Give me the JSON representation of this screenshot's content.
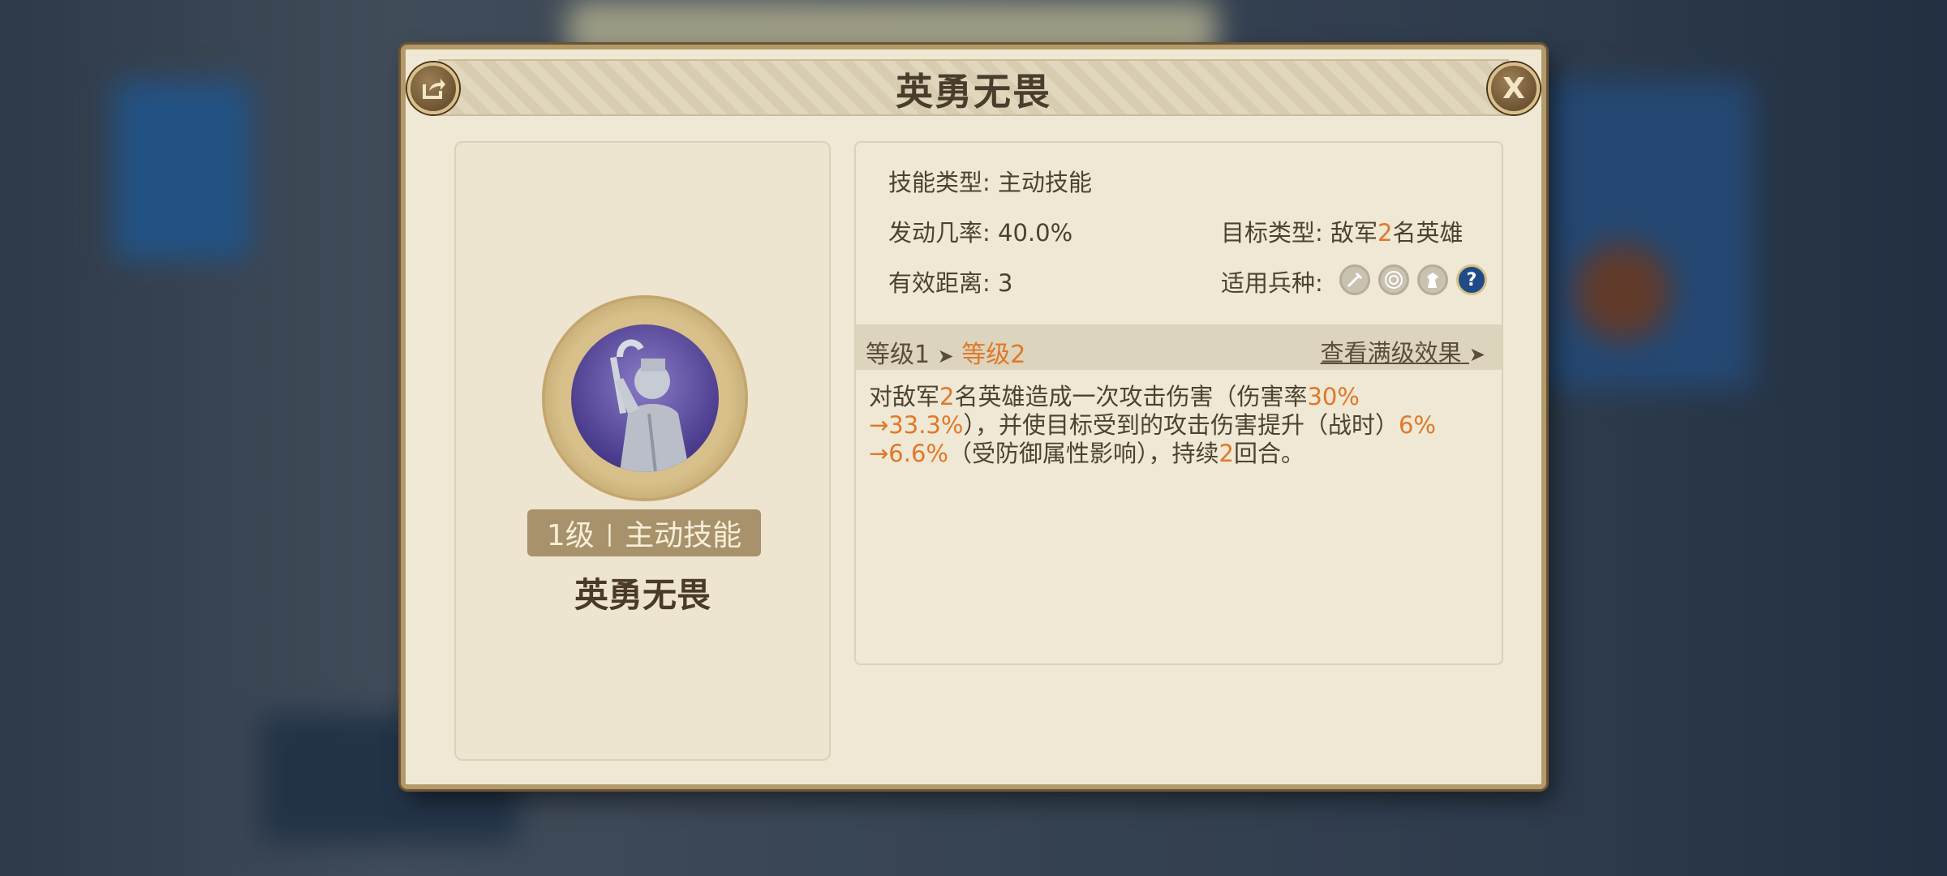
{
  "dialog": {
    "title": "英勇无畏",
    "close_label": "X"
  },
  "skill": {
    "level_badge": "1级",
    "type_badge": "主动技能",
    "name": "英勇无畏"
  },
  "info": {
    "skill_type_label": "技能类型:",
    "skill_type_value": "主动技能",
    "trigger_rate_label": "发动几率:",
    "trigger_rate_value": "40.0%",
    "target_type_label": "目标类型:",
    "target_type_prefix": "敌军",
    "target_type_count": "2",
    "target_type_suffix": "名英雄",
    "range_label": "有效距离:",
    "range_value": "3",
    "unit_label": "适用兵种:",
    "unit_icons": [
      "sword-icon",
      "target-icon",
      "horse-icon",
      "question-icon"
    ]
  },
  "level": {
    "current": "等级1",
    "arrow": "➤",
    "next": "等级2",
    "full_link": "查看满级效果",
    "full_arrow": "➤"
  },
  "description": {
    "p1": "对敌军",
    "n1": "2",
    "p2": "名英雄造成一次攻击伤害（伤害率",
    "n2": "30%",
    "n3": "→33.3%",
    "p3": "），并使目标受到的攻击伤害提升（战时）",
    "n4": "6%",
    "n5": "→6.6%",
    "p4": "（受防御属性影响），持续",
    "n6": "2",
    "p5": "回合。"
  },
  "colors": {
    "highlight": "#e0782a",
    "text": "#4c4232",
    "badge_bg": "#a8926b",
    "frame": "#b39a6a"
  }
}
